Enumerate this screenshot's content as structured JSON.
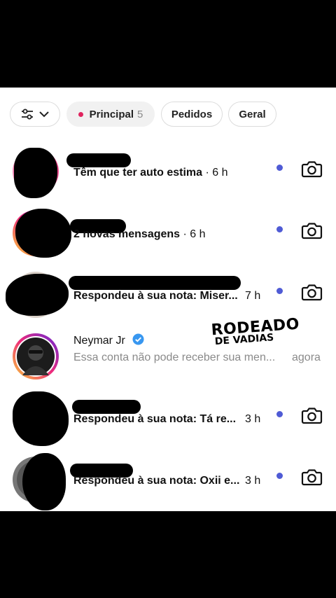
{
  "filters": {
    "principal_label": "Principal",
    "principal_count": "5",
    "pedidos_label": "Pedidos",
    "geral_label": "Geral"
  },
  "threads": [
    {
      "message": "Têm que ter auto estima",
      "time": "· 6 h"
    },
    {
      "message": "2 novas mensagens",
      "time": "· 6 h"
    },
    {
      "message": "Respondeu à sua nota: Miser...",
      "time": "7 h"
    },
    {
      "name": "Neymar Jr",
      "message": "Essa conta não pode receber sua men...",
      "time": "agora"
    },
    {
      "message": "Respondeu à sua nota: Tá re...",
      "time": "3 h"
    },
    {
      "message": "Respondeu à sua nota: Oxii e...",
      "time": "3 h"
    }
  ],
  "watermark": {
    "line1": "RODEADO",
    "line2": "DE VADIAS"
  },
  "colors": {
    "unread_dot": "#4f5bd5",
    "active_dot": "#e0245e",
    "verified": "#3897f0"
  },
  "icons": [
    "sliders-icon",
    "chevron-down-icon",
    "camera-icon",
    "verified-badge-icon"
  ]
}
